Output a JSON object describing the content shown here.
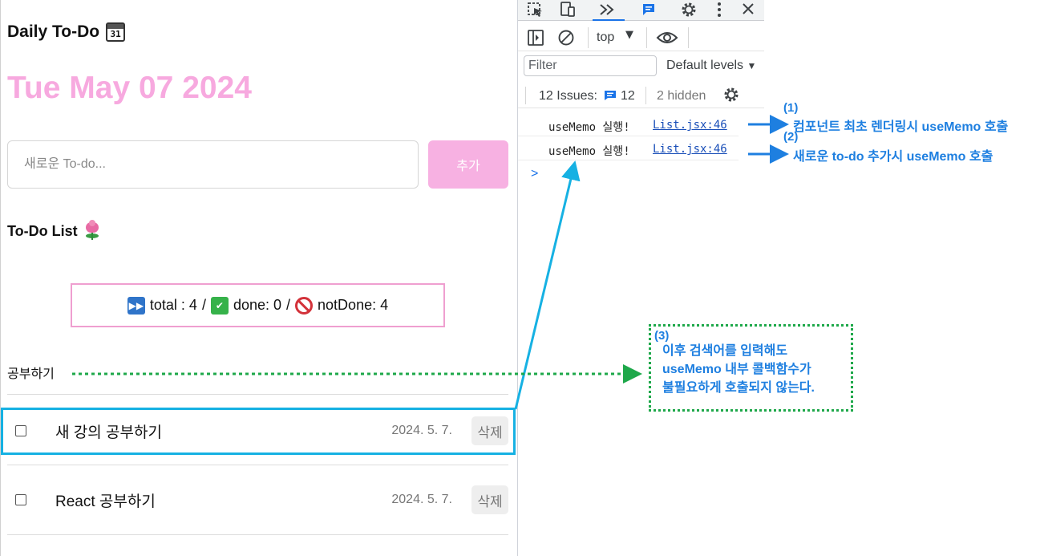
{
  "app": {
    "title": "Daily To-Do",
    "title_icon": "calendar-icon",
    "title_icon_text": "31",
    "date": "Tue May 07 2024",
    "date_color": "#f7a9df",
    "new_todo_placeholder": "새로운 To-do...",
    "add_button": "추가",
    "add_button_color": "#f7b1e2",
    "list_heading": "To-Do List",
    "list_heading_icon": "tulip-icon",
    "stats": {
      "total_label": "total : 4",
      "done_label": "done: 0",
      "not_done_label": "notDone: 4",
      "separator": "/",
      "total_icon": "fast-forward-icon",
      "done_icon": "check-mark-icon",
      "not_done_icon": "prohibited-icon",
      "border_color": "#ef9fd0"
    },
    "search_value": "공부하기",
    "todos": [
      {
        "content": "새 강의 공부하기",
        "date": "2024. 5. 7.",
        "delete_label": "삭제",
        "checked": false
      },
      {
        "content": "React 공부하기",
        "date": "2024. 5. 7.",
        "delete_label": "삭제",
        "checked": false
      }
    ]
  },
  "devtools": {
    "context": "top",
    "filter_placeholder": "Filter",
    "levels": "Default levels",
    "issues_label": "12 Issues:",
    "issues_count": "12",
    "hidden_label": "2 hidden",
    "console_lines": [
      {
        "message": "useMemo 실행!",
        "source": "List.jsx:46"
      },
      {
        "message": "useMemo 실행!",
        "source": "List.jsx:46"
      }
    ],
    "prompt": ">",
    "accent_color": "#1a73e8"
  },
  "annotations": {
    "note1": {
      "number": "(1)",
      "text": "컴포넌트 최초 렌더링시 useMemo 호출"
    },
    "note2": {
      "number": "(2)",
      "text": "새로운 to-do 추가시 useMemo 호출"
    },
    "note3": {
      "number": "(3)",
      "lines": [
        "이후 검색어를 입력해도",
        "useMemo 내부 콜백함수가",
        "불필요하게 호출되지 않는다."
      ]
    },
    "blue_color": "#1e7fe0",
    "cyan_color": "#16b1e3",
    "green_color": "#1ea84a"
  }
}
